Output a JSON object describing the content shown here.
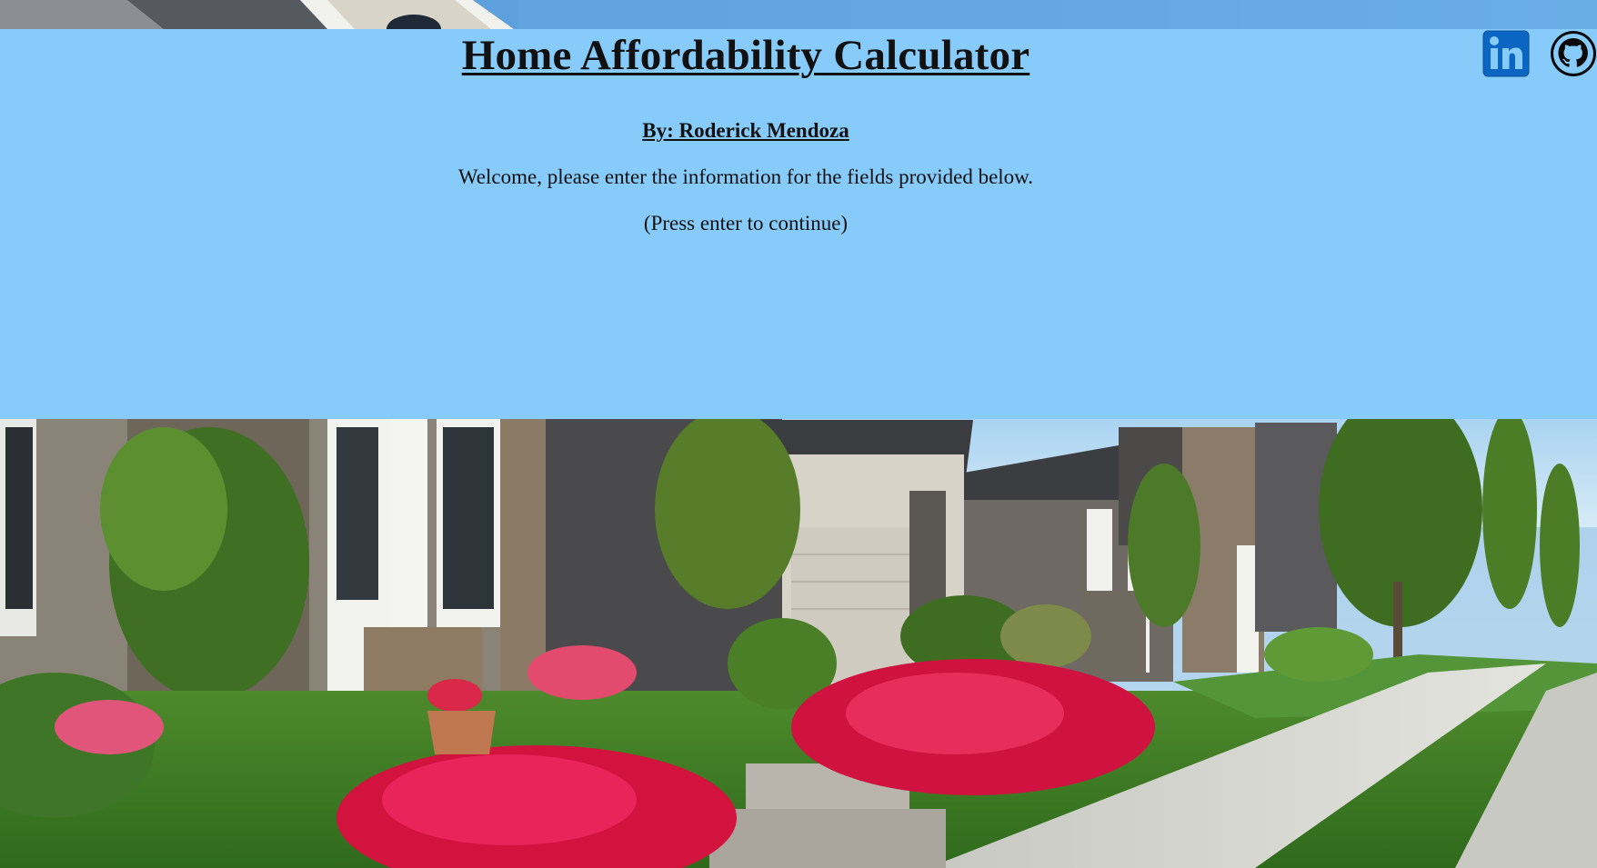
{
  "header": {
    "title": "Home Affordability Calculator",
    "author": "By: Roderick Mendoza",
    "welcome": "Welcome, please enter the information for the fields provided below.",
    "instruction": "(Press enter to continue)"
  },
  "social": {
    "linkedin_icon": "linkedin-icon",
    "github_icon": "github-icon"
  },
  "colors": {
    "panel": "#86cbfa",
    "sky": "#64a6e2",
    "linkedin": "#0a66c2",
    "text": "#111111"
  }
}
